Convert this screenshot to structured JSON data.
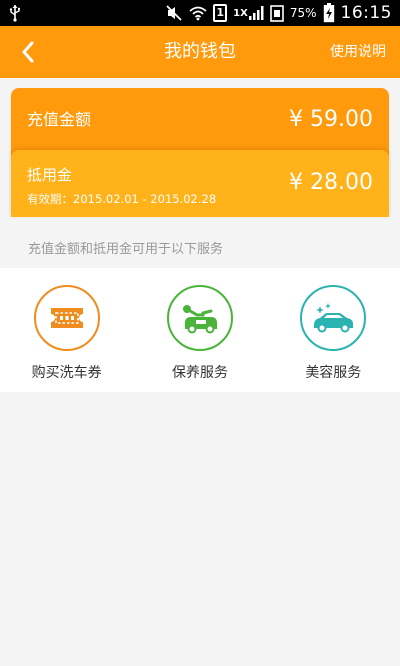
{
  "status_bar": {
    "network": "1X",
    "battery_percent": "75%",
    "time": "16:15"
  },
  "header": {
    "title": "我的钱包",
    "help_label": "使用说明"
  },
  "wallet": {
    "recharge": {
      "label": "充值金额",
      "amount": "¥ 59.00"
    },
    "voucher": {
      "label": "抵用金",
      "validity": "有效期：2015.02.01 - 2015.02.28",
      "amount": "¥ 28.00"
    }
  },
  "info_text": "充值金额和抵用金可用于以下服务",
  "services": [
    {
      "label": "购买洗车券",
      "icon": "ticket-icon",
      "color": "#f08c1e"
    },
    {
      "label": "保养服务",
      "icon": "car-maintenance-icon",
      "color": "#4ab33a"
    },
    {
      "label": "美容服务",
      "icon": "car-beauty-icon",
      "color": "#2ab3b0"
    }
  ],
  "colors": {
    "header_orange": "#ff9a0c",
    "voucher_orange": "#ffb21a"
  }
}
